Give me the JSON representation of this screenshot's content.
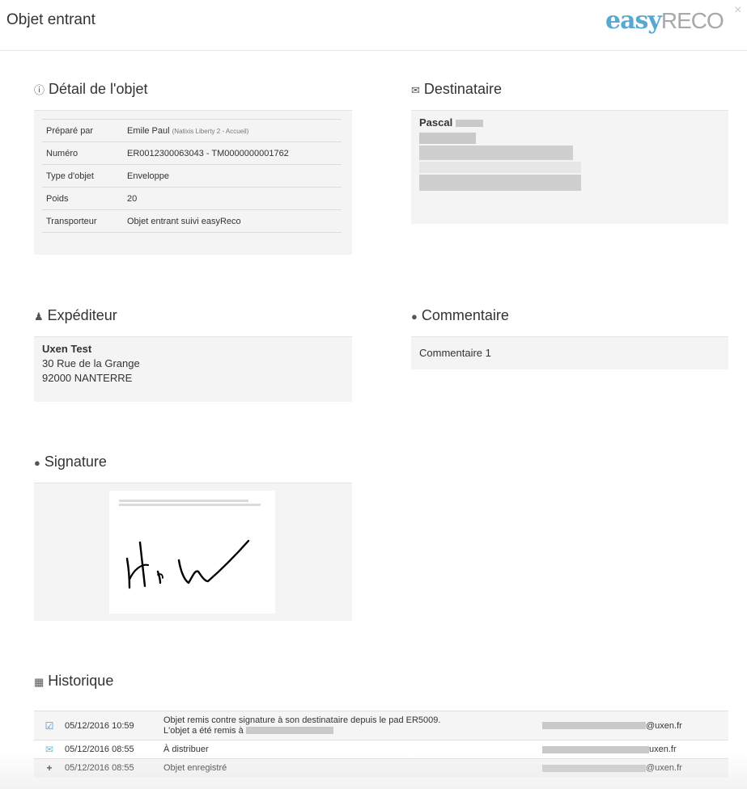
{
  "modal": {
    "title": "Objet entrant",
    "close": "×"
  },
  "logo": {
    "part1": "easy",
    "part2": "RECO"
  },
  "detail": {
    "title": "Détail de l'objet",
    "icon": "info-circle-icon",
    "rows": [
      {
        "label": "Préparé par",
        "value": "Emile Paul",
        "extra": "(Natixis Liberty 2 - Accueil)"
      },
      {
        "label": "Numéro",
        "value": "ER0012300063043 - TM0000000001762"
      },
      {
        "label": "Type d'objet",
        "value": "Enveloppe"
      },
      {
        "label": "Poids",
        "value": "20"
      },
      {
        "label": "Transporteur",
        "value": "Objet entrant suivi easyReco"
      }
    ]
  },
  "destinataire": {
    "title": "Destinataire",
    "icon": "envelope-icon",
    "name": "Pascal"
  },
  "expediteur": {
    "title": "Expéditeur",
    "icon": "user-icon",
    "name": "Uxen Test",
    "line1": "30 Rue de la Grange",
    "line2": "92000 NANTERRE"
  },
  "commentaire": {
    "title": "Commentaire",
    "icon": "comment-icon",
    "text": "Commentaire 1"
  },
  "signature": {
    "title": "Signature",
    "icon": "comment-icon"
  },
  "historique": {
    "title": "Historique",
    "icon": "calendar-icon",
    "rows": [
      {
        "icon": "check-square-icon",
        "date": "05/12/2016 10:59",
        "line1": "Objet remis contre signature à son destinataire depuis le pad ER5009.",
        "line2": "L'objet a été remis à",
        "email_suffix": "@uxen.fr"
      },
      {
        "icon": "envelope-outline-icon",
        "date": "05/12/2016 08:55",
        "line1": "À distribuer",
        "email_suffix": "uxen.fr"
      },
      {
        "icon": "plus-icon",
        "date": "05/12/2016 08:55",
        "line1": "Objet enregistré",
        "email_suffix": "@uxen.fr"
      }
    ]
  },
  "colors": {
    "accent": "#5aa8d2",
    "panel": "#f4f4f4",
    "icon_blue": "#3a8ee6"
  }
}
